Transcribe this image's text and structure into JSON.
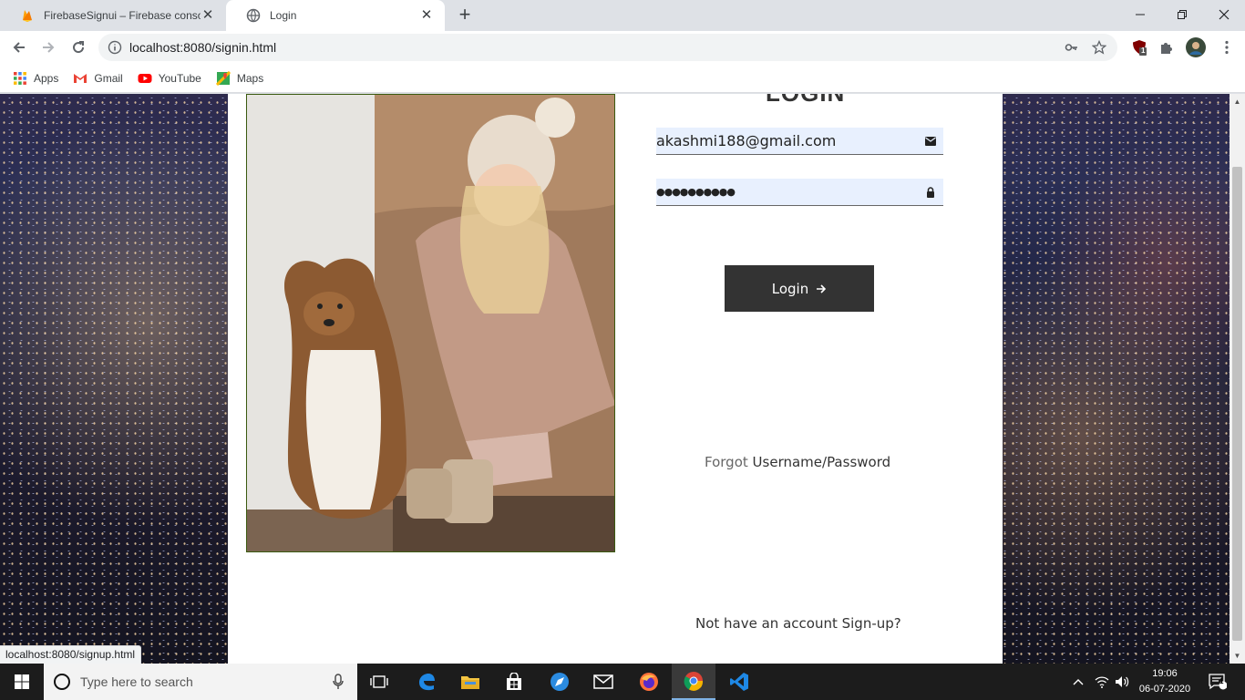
{
  "browser": {
    "tabs": [
      {
        "title": "FirebaseSignui – Firebase console",
        "active": false
      },
      {
        "title": "Login",
        "active": true
      }
    ],
    "url": "localhost:8080/signin.html",
    "bookmarks": [
      "Apps",
      "Gmail",
      "YouTube",
      "Maps"
    ],
    "status_url": "localhost:8080/signup.html",
    "extension_badge": "1"
  },
  "page": {
    "form_title": "LOGIN",
    "email_value": "akashmi188@gmail.com",
    "password_value": "●●●●●●●●●●",
    "login_label": "Login",
    "forgot_prefix": "Forgot",
    "forgot_link": "Username/Password",
    "signup_text": "Not have an account Sign-up?"
  },
  "taskbar": {
    "search_placeholder": "Type here to search",
    "time": "19:06",
    "date": "06-07-2020",
    "notification_count": "1"
  },
  "colors": {
    "button_bg": "#333333",
    "input_bg": "#e8f0fe",
    "taskbar_bg": "#1c1c1c"
  }
}
